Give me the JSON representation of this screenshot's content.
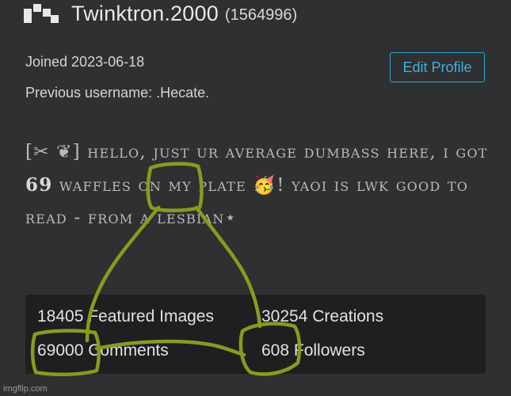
{
  "profile": {
    "username": "Twinktron.2000",
    "user_id": "(1564996)",
    "joined": "Joined 2023-06-18",
    "previous_username": "Previous username: .Hecate.",
    "edit_button": "Edit Profile"
  },
  "bio": {
    "part1": "[✂ ❦] HELLO, JUST UR AVERAGE DUMBASS HERE, I GOT ",
    "number": "69",
    "part2": " WAFFLES ON MY PLATE ",
    "emoji": "🥳",
    "part3": "! YAOI IS LWK GOOD TO READ - FROM A LESBIAN",
    "star": "⋆"
  },
  "stats": {
    "featured_images": "18405 Featured Images",
    "creations": "30254 Creations",
    "comments": "69000 Comments",
    "followers": "608 Followers"
  },
  "watermark": "imgflip.com",
  "colors": {
    "accent": "#33a9d8",
    "scribble": "#8a9a1e",
    "background": "#2f3031"
  }
}
